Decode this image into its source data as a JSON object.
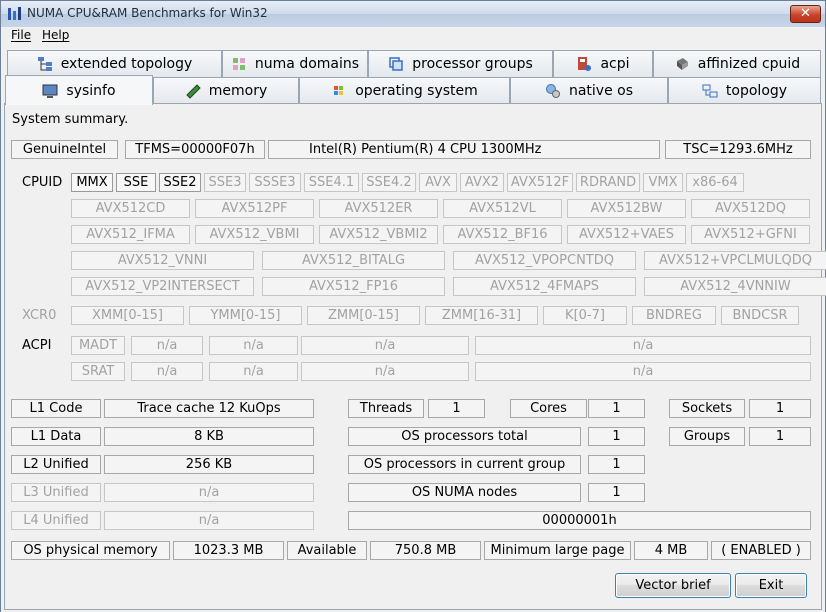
{
  "window": {
    "title": "NUMA CPU&RAM Benchmarks for Win32",
    "close_glyph": "✕"
  },
  "menu": {
    "file": "File",
    "help": "Help"
  },
  "tabs_row1": [
    {
      "label": "extended topology",
      "icon": "topology-tree-icon"
    },
    {
      "label": "numa domains",
      "icon": "numa-grid-icon"
    },
    {
      "label": "processor groups",
      "icon": "processor-groups-icon"
    },
    {
      "label": "acpi",
      "icon": "acpi-icon"
    },
    {
      "label": "affinized cpuid",
      "icon": "chip-icon"
    }
  ],
  "tabs_row2": [
    {
      "label": "sysinfo",
      "icon": "monitor-icon",
      "active": true
    },
    {
      "label": "memory",
      "icon": "memory-stick-icon"
    },
    {
      "label": "operating system",
      "icon": "windows-logo-icon"
    },
    {
      "label": "native os",
      "icon": "native-os-icon"
    },
    {
      "label": "topology",
      "icon": "topology-icon"
    }
  ],
  "summary": {
    "heading": "System summary.",
    "vendor": "GenuineIntel",
    "tfms": "TFMS=00000F07h",
    "cpu_name": "Intel(R) Pentium(R) 4 CPU 1300MHz",
    "tsc": "TSC=1293.6MHz"
  },
  "cpuid": {
    "label": "CPUID",
    "row1": [
      {
        "t": "MMX",
        "on": true
      },
      {
        "t": "SSE",
        "on": true
      },
      {
        "t": "SSE2",
        "on": true
      },
      {
        "t": "SSE3",
        "on": false
      },
      {
        "t": "SSSE3",
        "on": false
      },
      {
        "t": "SSE4.1",
        "on": false
      },
      {
        "t": "SSE4.2",
        "on": false
      },
      {
        "t": "AVX",
        "on": false
      },
      {
        "t": "AVX2",
        "on": false
      },
      {
        "t": "AVX512F",
        "on": false
      },
      {
        "t": "RDRAND",
        "on": false
      },
      {
        "t": "VMX",
        "on": false
      },
      {
        "t": "x86-64",
        "on": false
      }
    ],
    "row2": [
      "AVX512CD",
      "AVX512PF",
      "AVX512ER",
      "AVX512VL",
      "AVX512BW",
      "AVX512DQ"
    ],
    "row3": [
      "AVX512_IFMA",
      "AVX512_VBMI",
      "AVX512_VBMI2",
      "AVX512_BF16",
      "AVX512+VAES",
      "AVX512+GFNI"
    ],
    "row4": [
      "AVX512_VNNI",
      "AVX512_BITALG",
      "AVX512_VPOPCNTDQ",
      "AVX512+VPCLMULQDQ"
    ],
    "row5": [
      "AVX512_VP2INTERSECT",
      "AVX512_FP16",
      "AVX512_4FMAPS",
      "AVX512_4VNNIW"
    ]
  },
  "xcr0": {
    "label": "XCR0",
    "items": [
      "XMM[0-15]",
      "YMM[0-15]",
      "ZMM[0-15]",
      "ZMM[16-31]",
      "K[0-7]",
      "BNDREG",
      "BNDCSR"
    ]
  },
  "acpi": {
    "label": "ACPI",
    "madt": [
      "MADT",
      "n/a",
      "n/a",
      "n/a",
      "n/a"
    ],
    "srat": [
      "SRAT",
      "n/a",
      "n/a",
      "n/a",
      "n/a"
    ]
  },
  "cache": {
    "l1_code_label": "L1 Code",
    "l1_code_value": "Trace cache 12 KuOps",
    "l1_data_label": "L1 Data",
    "l1_data_value": "8 KB",
    "l2_label": "L2 Unified",
    "l2_value": "256 KB",
    "l3_label": "L3 Unified",
    "l3_value": "n/a",
    "l4_label": "L4 Unified",
    "l4_value": "n/a"
  },
  "topology": {
    "threads_label": "Threads",
    "threads": "1",
    "cores_label": "Cores",
    "cores": "1",
    "sockets_label": "Sockets",
    "sockets": "1",
    "os_total_label": "OS processors total",
    "os_total": "1",
    "groups_label": "Groups",
    "groups": "1",
    "os_group_label": "OS processors in current group",
    "os_group": "1",
    "numa_nodes_label": "OS NUMA nodes",
    "numa_nodes": "1",
    "affinity_mask": "00000001h"
  },
  "memory": {
    "phys_label": "OS physical memory",
    "phys_value": "1023.3 MB",
    "avail_label": "Available",
    "avail_value": "750.8 MB",
    "large_page_label": "Minimum large page",
    "large_page_value": "4 MB",
    "large_page_status": "( ENABLED )"
  },
  "buttons": {
    "vector_brief": "Vector brief",
    "exit": "Exit"
  },
  "colors": {
    "title_bar": "#cfdbeb",
    "close_button": "#c8452b",
    "button_border": "#3c7fb1",
    "disabled_text": "#a2a2a2"
  }
}
